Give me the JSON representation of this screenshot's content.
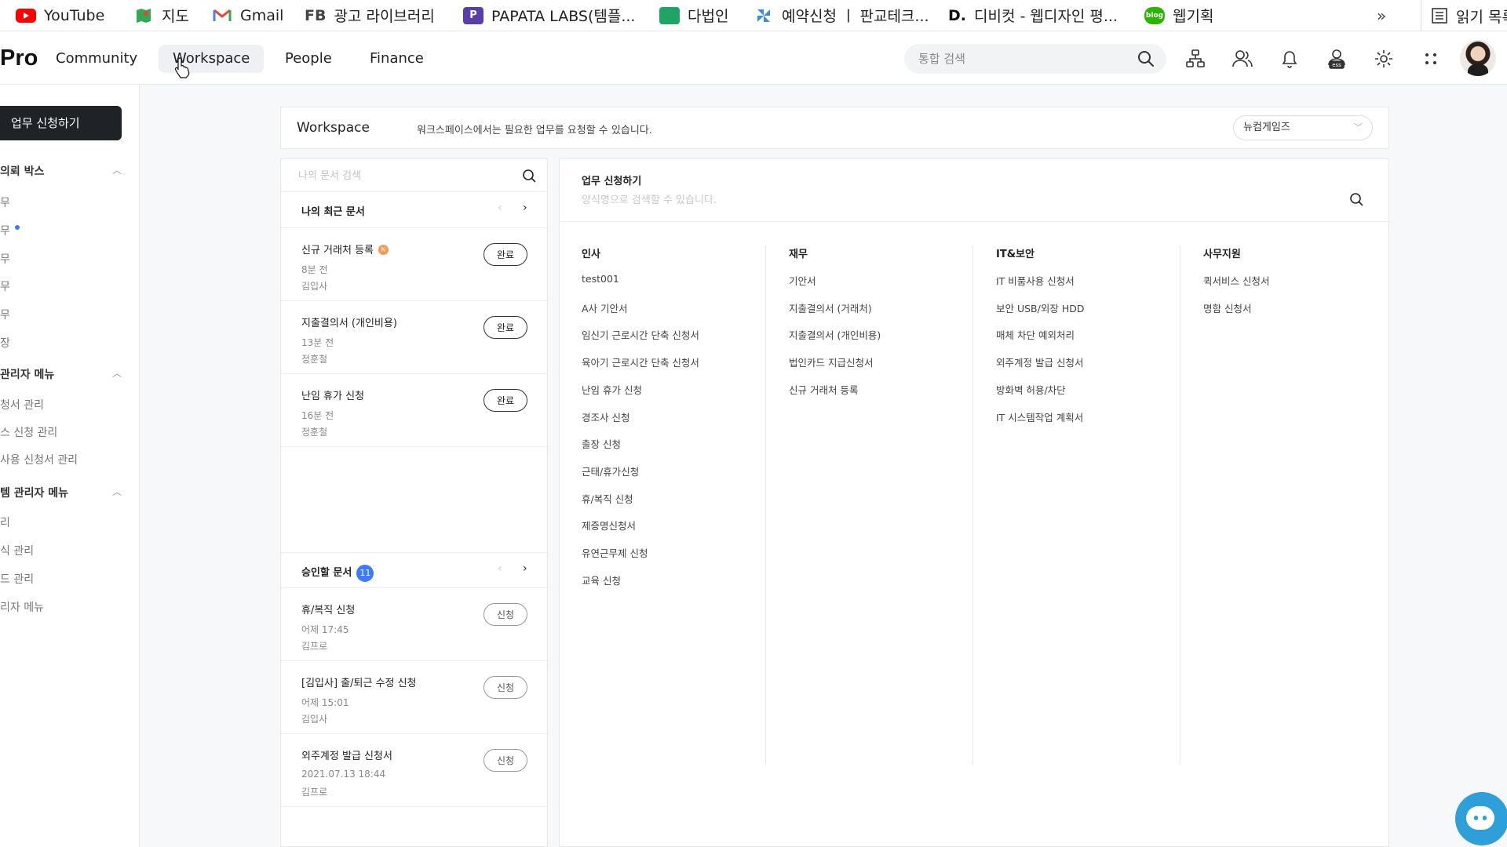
{
  "bookmarks": {
    "items": [
      {
        "label": "YouTube",
        "icon": "youtube-icon",
        "color": "#ff0000"
      },
      {
        "label": "지도",
        "icon": "maps-icon",
        "color": "#34a853"
      },
      {
        "label": "Gmail",
        "icon": "gmail-icon",
        "color": "#ea4335"
      },
      {
        "label": "광고 라이브러리",
        "icon": "fb-text-icon",
        "prefix": "FB",
        "color": "#444444"
      },
      {
        "label": "PAPATA LABS(템플...",
        "icon": "papata-icon",
        "prefix": "P",
        "color": "#5a3ea8"
      },
      {
        "label": "다법인",
        "icon": "sheet-icon",
        "color": "#1fa463"
      },
      {
        "label": "예약신청 ㅣ 판교테크...",
        "icon": "pinwheel-icon",
        "color": "#3a8fd6"
      },
      {
        "label": "디비컷 - 웹디자인 평...",
        "icon": "dbcut-icon",
        "prefix": "D.",
        "color": "#111111"
      },
      {
        "label": "웹기획",
        "icon": "blog-icon",
        "prefix": "blog",
        "color": "#2db400"
      }
    ],
    "more": "»",
    "reading_list": "읽기 목록"
  },
  "nav": {
    "logo": "Pro",
    "items": [
      "Community",
      "Workspace",
      "People",
      "Finance"
    ],
    "active": "Workspace",
    "search_placeholder": "통합 검색",
    "icons": [
      "org-chart-icon",
      "people-icon",
      "bell-icon",
      "ess-icon",
      "gear-icon",
      "apps-grid-icon"
    ]
  },
  "sidebar": {
    "request_button": "업무 신청하기",
    "sections": [
      {
        "title": "의뢰 박스",
        "items": [
          "무",
          "무",
          "무",
          "무",
          "무",
          "장"
        ],
        "dot_index": 1
      },
      {
        "title": "관리자 메뉴",
        "items": [
          "청서 관리",
          "스 신청 관리",
          "사용 신청서 관리"
        ]
      },
      {
        "title": "템 관리자 메뉴",
        "items": [
          "리",
          "식 관리",
          "드 관리",
          "리자 메뉴"
        ]
      }
    ]
  },
  "workspace": {
    "title": "Workspace",
    "description": "워크스페이스에서는 필요한 업무를 요청할 수 있습니다.",
    "company_select": "뉴컴게임즈"
  },
  "left_panel": {
    "search_placeholder": "나의 문서 검색",
    "recent": {
      "title": "나의 최근 문서",
      "docs": [
        {
          "title": "신규 거래처 등록",
          "new": "N",
          "time": "8분 전",
          "user": "김입사",
          "status": "완료"
        },
        {
          "title": "지출결의서 (개인비용)",
          "time": "13분 전",
          "user": "정훈철",
          "status": "완료"
        },
        {
          "title": "난임 휴가 신청",
          "time": "16분 전",
          "user": "정훈철",
          "status": "완료"
        }
      ]
    },
    "approve": {
      "title": "승인할 문서",
      "count": "11",
      "docs": [
        {
          "title": "휴/복직 신청",
          "time": "어제 17:45",
          "user": "김프로",
          "status": "신청"
        },
        {
          "title": "[김입사] 출/퇴근 수정 신청",
          "time": "어제 15:01",
          "user": "김입사",
          "status": "신청"
        },
        {
          "title": "외주계정 발급 신청서",
          "time": "2021.07.13 18:44",
          "user": "김프로",
          "status": "신청"
        }
      ]
    }
  },
  "right_panel": {
    "title": "업무 신청하기",
    "search_placeholder": "양식명으로 검색할 수 있습니다.",
    "categories": [
      {
        "title": "인사",
        "items": [
          "test001",
          "A사 기안서",
          "임신기 근로시간 단축 신청서",
          "육아기 근로시간 단축 신청서",
          "난임 휴가 신청",
          "경조사 신청",
          "출장 신청",
          "근태/휴가신청",
          "휴/복직 신청",
          "제증명신청서",
          "유연근무제 신청",
          "교육 신청"
        ]
      },
      {
        "title": "재무",
        "items": [
          "기안서",
          "지출결의서 (거래처)",
          "지출결의서 (개인비용)",
          "법인카드 지급신청서",
          "신규 거래처 등록"
        ]
      },
      {
        "title": "IT&보안",
        "items": [
          "IT 비품사용 신청서",
          "보안 USB/외장 HDD",
          "매체 차단 예외처리",
          "외주계정 발급 신청서",
          "방화벽 허용/차단",
          "IT 시스템작업 계획서"
        ]
      },
      {
        "title": "사무지원",
        "items": [
          "퀵서비스 신청서",
          "명함 신청서"
        ]
      }
    ]
  }
}
